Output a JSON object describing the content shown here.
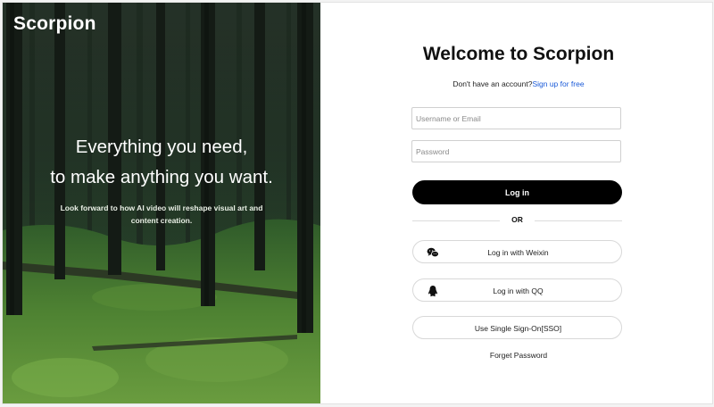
{
  "brand": {
    "name": "Scorpion"
  },
  "hero": {
    "headline_line1": "Everything you need,",
    "headline_line2": "to make anything  you want.",
    "tagline": "Look forward to how AI video will reshape visual art and content creation."
  },
  "login": {
    "title": "Welcome to Scorpion",
    "signup_prompt": "Don't have an account?",
    "signup_link": "Sign up for free",
    "username_placeholder": "Username or Email",
    "password_placeholder": "Password",
    "login_button": "Log in",
    "divider_text": "OR",
    "weixin_button": "Log in with Weixin",
    "qq_button": "Log in with QQ",
    "sso_button": "Use Single Sign-On[SSO]",
    "forget_password": "Forget Password"
  },
  "colors": {
    "accent_link": "#1a5ad8",
    "primary_button": "#000000",
    "forest_dark": "#101712",
    "moss_green": "#5a8a37"
  },
  "icons": {
    "weixin": "wechat-icon",
    "qq": "qq-penguin-icon"
  }
}
